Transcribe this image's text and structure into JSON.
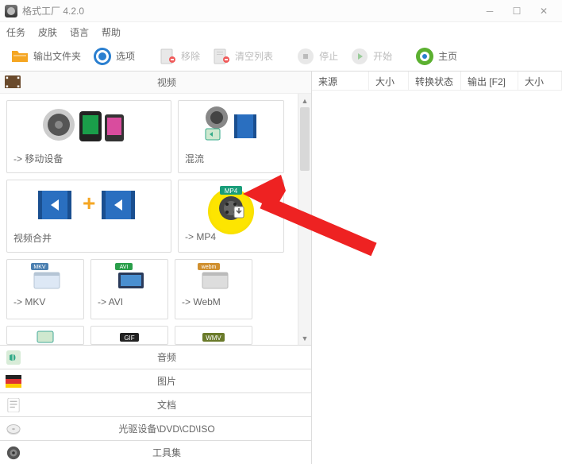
{
  "window": {
    "title": "格式工厂 4.2.0"
  },
  "menu": {
    "tasks": "任务",
    "skin": "皮肤",
    "lang": "语言",
    "help": "帮助"
  },
  "toolbar": {
    "output_folder": "输出文件夹",
    "options": "选项",
    "remove": "移除",
    "clear": "清空列表",
    "stop": "停止",
    "start": "开始",
    "home": "主页"
  },
  "categories": {
    "video": "视频",
    "audio": "音频",
    "image": "图片",
    "doc": "文档",
    "disc": "光驱设备\\DVD\\CD\\ISO",
    "toolkit": "工具集"
  },
  "tiles": {
    "mobile": "-> 移动设备",
    "mux": "混流",
    "merge": "视频合并",
    "mp4": "-> MP4",
    "mkv": "-> MKV",
    "avi": "-> AVI",
    "webm": "-> WebM"
  },
  "listhdr": {
    "source": "来源",
    "size": "大小",
    "status": "转换状态",
    "output": "输出 [F2]",
    "size2": "大小"
  },
  "badges": {
    "mp4": "MP4",
    "mkv": "MKV",
    "avi": "AVI",
    "webm": "webm",
    "gif": "GIF",
    "wmv": "WMV"
  }
}
